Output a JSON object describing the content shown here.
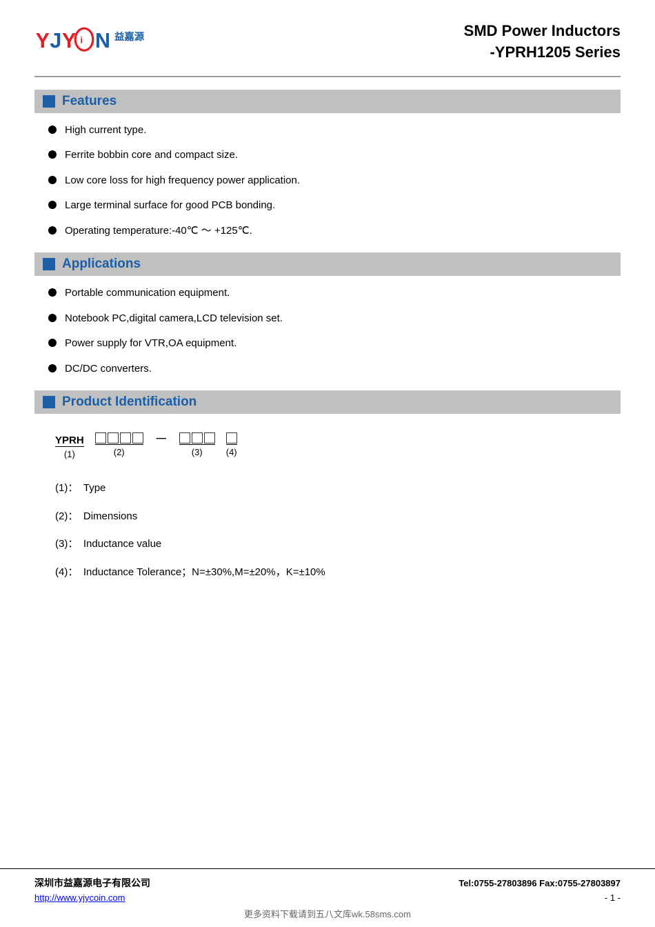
{
  "header": {
    "logo_alt": "YJYCOIN 益嘉源",
    "logo_cn": "益嘉源",
    "title_line1": "SMD Power Inductors",
    "title_line2": "-YPRH1205 Series"
  },
  "features": {
    "section_title": "Features",
    "items": [
      "High current type.",
      "Ferrite bobbin core and compact size.",
      "Low core loss for high frequency power application.",
      "Large terminal surface for good PCB bonding.",
      "Operating temperature:-40℃ ～ +125℃."
    ]
  },
  "applications": {
    "section_title": "Applications",
    "items": [
      "Portable communication equipment.",
      "Notebook PC,digital camera,LCD television set.",
      "Power supply for VTR,OA equipment.",
      "DC/DC converters."
    ]
  },
  "product_id": {
    "section_title": "Product Identification",
    "diagram_yprh": "YPRH",
    "diagram_label1": "(1)",
    "diagram_label2": "(2)",
    "diagram_label3": "(3)",
    "diagram_label4": "(4)",
    "details": [
      {
        "num": "(1)",
        "label": "Type"
      },
      {
        "num": "(2)",
        "label": "Dimensions"
      },
      {
        "num": "(3)",
        "label": "Inductance value"
      },
      {
        "num": "(4)",
        "label": "Inductance Tolerance；N=±30%,M=±20%，K=±10%"
      }
    ]
  },
  "footer": {
    "company": "深圳市益嘉源电子有限公司",
    "contact": "Tel:0755-27803896   Fax:0755-27803897",
    "url": "http://www.yjycoin.com",
    "page": "- 1 -",
    "watermark": "更多资料下载请到五八文库wk.58sms.com"
  }
}
